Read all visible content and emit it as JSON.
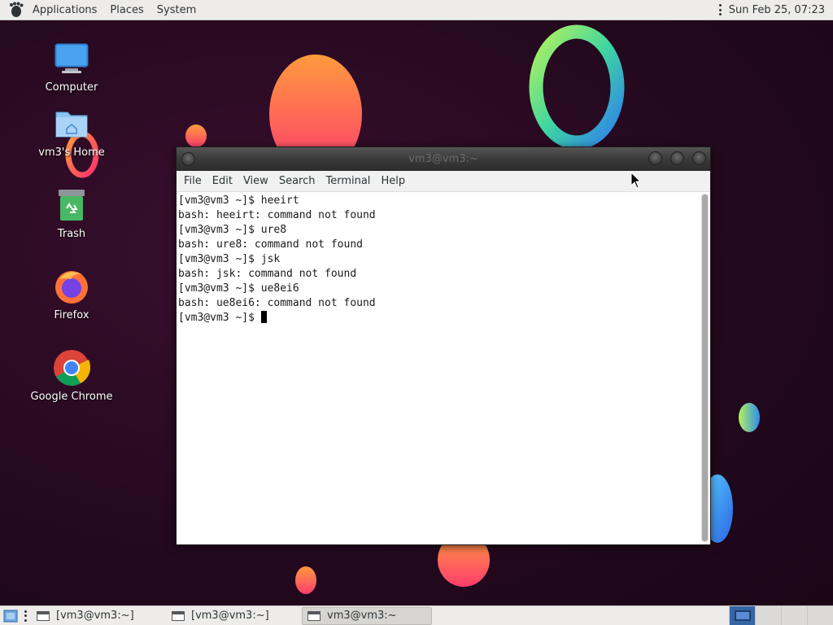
{
  "top_panel": {
    "menus": [
      "Applications",
      "Places",
      "System"
    ],
    "clock": "Sun Feb 25, 07:23"
  },
  "desktop_icons": [
    {
      "label": "Computer",
      "icon": "computer-icon"
    },
    {
      "label": "vm3's Home",
      "icon": "home-folder-icon"
    },
    {
      "label": "Trash",
      "icon": "trash-icon"
    },
    {
      "label": "Firefox",
      "icon": "firefox-icon"
    },
    {
      "label": "Google Chrome",
      "icon": "chrome-icon"
    }
  ],
  "terminal": {
    "title": "vm3@vm3:~",
    "menu": [
      "File",
      "Edit",
      "View",
      "Search",
      "Terminal",
      "Help"
    ],
    "lines": [
      "[vm3@vm3 ~]$ heeirt",
      "bash: heeirt: command not found",
      "[vm3@vm3 ~]$ ure8",
      "bash: ure8: command not found",
      "[vm3@vm3 ~]$ jsk",
      "bash: jsk: command not found",
      "[vm3@vm3 ~]$ ue8ei6",
      "bash: ue8ei6: command not found"
    ],
    "prompt": "[vm3@vm3 ~]$ "
  },
  "taskbar": {
    "items": [
      {
        "label": "[vm3@vm3:~]",
        "active": false
      },
      {
        "label": "[vm3@vm3:~]",
        "active": false
      },
      {
        "label": "vm3@vm3:~",
        "active": true
      }
    ],
    "workspace_count": 4,
    "active_workspace": 1
  },
  "colors": {
    "panel_bg": "#edecea",
    "desktop_bg": "#24091f",
    "titlebar": "#3a3a3a",
    "workspace_active": "#3465a4"
  }
}
